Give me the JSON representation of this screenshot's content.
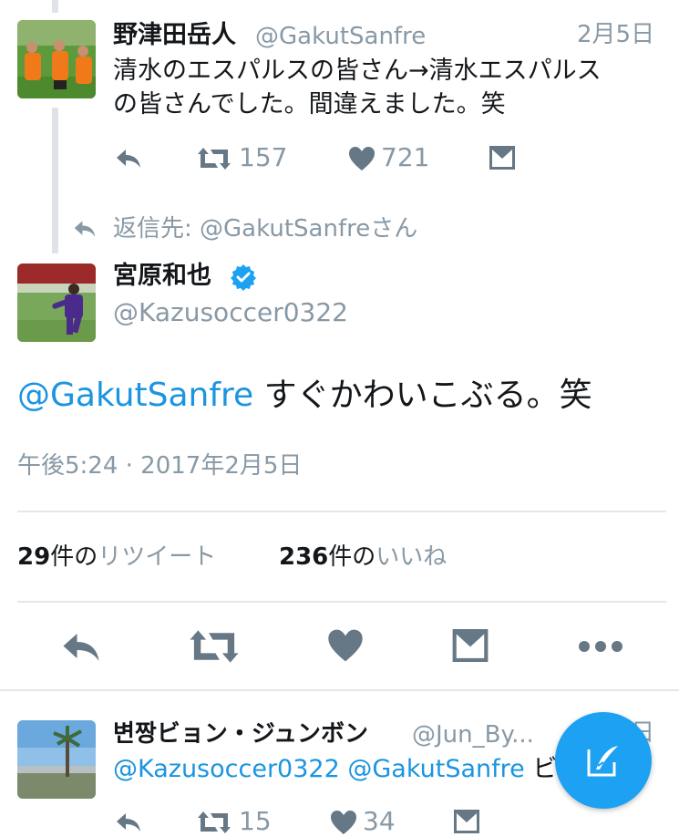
{
  "tweet1": {
    "name": "野津田岳人",
    "handle": "@GakutSanfre",
    "date": "2月5日",
    "text_line1": "清水のエスパルスの皆さん→清水エスパルス",
    "text_line2": "の皆さんでした。間違えました。笑",
    "retweets": "157",
    "likes": "721"
  },
  "reply_context": {
    "prefix": "返信先: ",
    "handle": "@GakutSanfreさん"
  },
  "main_tweet": {
    "name": "宮原和也",
    "handle": "@Kazusoccer0322",
    "mention": "@GakutSanfre",
    "text": " すぐかわいこぶる。笑",
    "timestamp": "午後5:24 · 2017年2月5日",
    "retweet_count": "29",
    "retweet_label_a": "件の",
    "retweet_label_b": "リツイート",
    "like_count": "236",
    "like_label_a": "件の",
    "like_label_b": "いいね"
  },
  "tweet3": {
    "name": "변짱ビョン・ジュンボン",
    "handle": "@Jun_By...",
    "date": "2月5日",
    "mention1": "@Kazusoccer0322",
    "mention2": "@GakutSanfre",
    "text_tail": " ビ",
    "retweets": "15",
    "likes": "34"
  },
  "colors": {
    "accent": "#1da1f2",
    "link": "#1b95e0",
    "icon_gray": "#667785",
    "verified": "#1da1f2"
  },
  "icons": [
    "reply-icon",
    "retweet-icon",
    "heart-icon",
    "dm-icon",
    "more-icon",
    "verified-icon",
    "compose-icon"
  ]
}
